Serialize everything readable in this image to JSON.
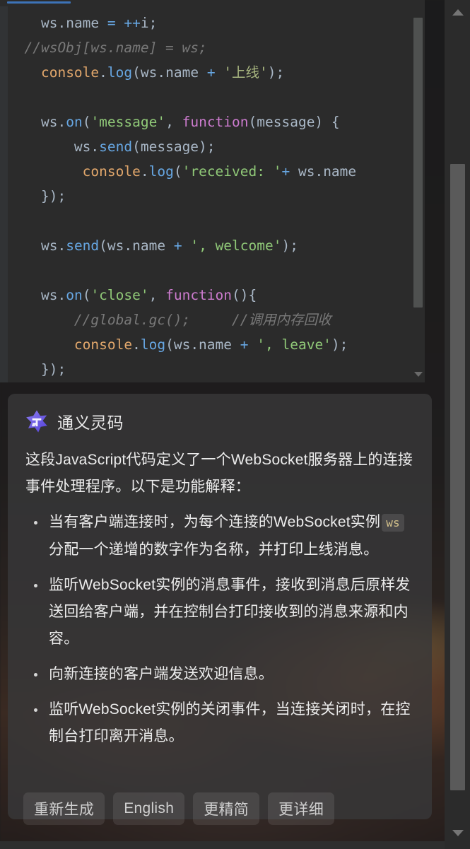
{
  "editor": {
    "tab_active_indicator": true,
    "language": "javascript",
    "lines": [
      [
        {
          "t": "    ",
          "c": "tok-punct"
        },
        {
          "t": "ws",
          "c": "tok-def"
        },
        {
          "t": ".",
          "c": "tok-punct"
        },
        {
          "t": "name",
          "c": "tok-def"
        },
        {
          "t": " ",
          "c": "tok-punct"
        },
        {
          "t": "=",
          "c": "tok-op"
        },
        {
          "t": " ",
          "c": "tok-punct"
        },
        {
          "t": "++",
          "c": "tok-op"
        },
        {
          "t": "i;",
          "c": "tok-def"
        }
      ],
      [
        {
          "t": "  //wsObj[ws.name] = ws;",
          "c": "tok-cmt"
        }
      ],
      [
        {
          "t": "    ",
          "c": "tok-punct"
        },
        {
          "t": "console",
          "c": "tok-cls"
        },
        {
          "t": ".",
          "c": "tok-punct"
        },
        {
          "t": "log",
          "c": "tok-fn"
        },
        {
          "t": "(ws.name ",
          "c": "tok-def"
        },
        {
          "t": "+",
          "c": "tok-op"
        },
        {
          "t": " ",
          "c": "tok-punct"
        },
        {
          "t": "'上线'",
          "c": "tok-cn"
        },
        {
          "t": ");",
          "c": "tok-punct"
        }
      ],
      [
        {
          "t": "",
          "c": "tok-punct"
        }
      ],
      [
        {
          "t": "    ",
          "c": "tok-punct"
        },
        {
          "t": "ws",
          "c": "tok-def"
        },
        {
          "t": ".",
          "c": "tok-punct"
        },
        {
          "t": "on",
          "c": "tok-fn"
        },
        {
          "t": "(",
          "c": "tok-punct"
        },
        {
          "t": "'message'",
          "c": "tok-str"
        },
        {
          "t": ", ",
          "c": "tok-punct"
        },
        {
          "t": "function",
          "c": "tok-kw"
        },
        {
          "t": "(message) {",
          "c": "tok-def"
        }
      ],
      [
        {
          "t": "        ",
          "c": "tok-punct"
        },
        {
          "t": "ws",
          "c": "tok-def"
        },
        {
          "t": ".",
          "c": "tok-punct"
        },
        {
          "t": "send",
          "c": "tok-fn"
        },
        {
          "t": "(message);",
          "c": "tok-def"
        }
      ],
      [
        {
          "t": "         ",
          "c": "tok-punct"
        },
        {
          "t": "console",
          "c": "tok-cls"
        },
        {
          "t": ".",
          "c": "tok-punct"
        },
        {
          "t": "log",
          "c": "tok-fn"
        },
        {
          "t": "(",
          "c": "tok-punct"
        },
        {
          "t": "'received: '",
          "c": "tok-str"
        },
        {
          "t": "+",
          "c": "tok-op"
        },
        {
          "t": " ws.name",
          "c": "tok-def"
        }
      ],
      [
        {
          "t": "    });",
          "c": "tok-punct"
        }
      ],
      [
        {
          "t": "",
          "c": "tok-punct"
        }
      ],
      [
        {
          "t": "    ",
          "c": "tok-punct"
        },
        {
          "t": "ws",
          "c": "tok-def"
        },
        {
          "t": ".",
          "c": "tok-punct"
        },
        {
          "t": "send",
          "c": "tok-fn"
        },
        {
          "t": "(ws.name ",
          "c": "tok-def"
        },
        {
          "t": "+",
          "c": "tok-op"
        },
        {
          "t": " ",
          "c": "tok-punct"
        },
        {
          "t": "', welcome'",
          "c": "tok-str"
        },
        {
          "t": ");",
          "c": "tok-punct"
        }
      ],
      [
        {
          "t": "",
          "c": "tok-punct"
        }
      ],
      [
        {
          "t": "    ",
          "c": "tok-punct"
        },
        {
          "t": "ws",
          "c": "tok-def"
        },
        {
          "t": ".",
          "c": "tok-punct"
        },
        {
          "t": "on",
          "c": "tok-fn"
        },
        {
          "t": "(",
          "c": "tok-punct"
        },
        {
          "t": "'close'",
          "c": "tok-str"
        },
        {
          "t": ", ",
          "c": "tok-punct"
        },
        {
          "t": "function",
          "c": "tok-kw"
        },
        {
          "t": "(){",
          "c": "tok-def"
        }
      ],
      [
        {
          "t": "        //global.gc();     //调用内存回收",
          "c": "tok-cmt"
        }
      ],
      [
        {
          "t": "        ",
          "c": "tok-punct"
        },
        {
          "t": "console",
          "c": "tok-cls"
        },
        {
          "t": ".",
          "c": "tok-punct"
        },
        {
          "t": "log",
          "c": "tok-fn"
        },
        {
          "t": "(ws.name ",
          "c": "tok-def"
        },
        {
          "t": "+",
          "c": "tok-op"
        },
        {
          "t": " ",
          "c": "tok-punct"
        },
        {
          "t": "', leave'",
          "c": "tok-str"
        },
        {
          "t": ");",
          "c": "tok-punct"
        }
      ],
      [
        {
          "t": "    });",
          "c": "tok-punct"
        }
      ]
    ],
    "syntax_colors": {
      "default": "#a9b7c6",
      "function": "#67a7e3",
      "keyword": "#cc7bce",
      "string": "#90c978",
      "cjk_string": "#a9b780",
      "class": "#e3a86c",
      "operator": "#67a7e3",
      "comment": "#787878",
      "background": "#2b2b2b"
    },
    "tab_accent_color": "#3d73b8"
  },
  "assistant": {
    "logo_name": "tongyi-lingma-logo",
    "logo_color": "#6a5ae0",
    "title": "通义灵码",
    "intro": "这段JavaScript代码定义了一个WebSocket服务器上的连接事件处理程序。以下是功能解释：",
    "bullets": [
      {
        "prefix": "当有客户端连接时，为每个连接的WebSocket实例",
        "code": "ws",
        "suffix": "分配一个递增的数字作为名称，并打印上线消息。"
      },
      {
        "prefix": "监听WebSocket实例的消息事件，接收到消息后原样发送回给客户端，并在控制台打印接收到的消息来源和内容。",
        "code": "",
        "suffix": ""
      },
      {
        "prefix": "向新连接的客户端发送欢迎信息。",
        "code": "",
        "suffix": ""
      },
      {
        "prefix": "监听WebSocket实例的关闭事件，当连接关闭时，在控制台打印离开消息。",
        "code": "",
        "suffix": ""
      }
    ],
    "actions": [
      {
        "label": "重新生成",
        "name": "regenerate-button"
      },
      {
        "label": "English",
        "name": "english-button"
      },
      {
        "label": "更精简",
        "name": "more-concise-button"
      },
      {
        "label": "更详细",
        "name": "more-detailed-button"
      }
    ]
  },
  "scrollbars": {
    "editor_scrollbar_name": "editor-vertical-scrollbar",
    "window_scrollbar_name": "window-vertical-scrollbar"
  }
}
